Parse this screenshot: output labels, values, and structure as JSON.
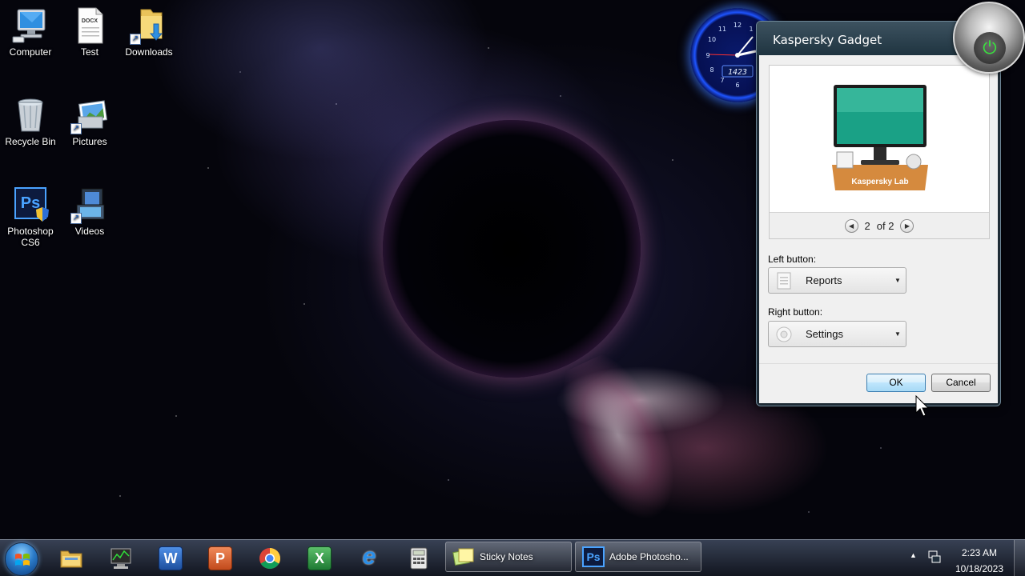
{
  "desktop": {
    "icons": [
      {
        "id": "computer",
        "label": "Computer",
        "icon": "computer-icon"
      },
      {
        "id": "test",
        "label": "Test",
        "icon": "docx-file-icon",
        "badge": "DOCX"
      },
      {
        "id": "downloads",
        "label": "Downloads",
        "icon": "downloads-folder-icon"
      },
      {
        "id": "recycle",
        "label": "Recycle Bin",
        "icon": "recycle-bin-icon"
      },
      {
        "id": "pictures",
        "label": "Pictures",
        "icon": "pictures-icon"
      },
      {
        "id": "photoshop",
        "label": "Photoshop CS6",
        "icon": "photoshop-icon",
        "glyph": "Ps"
      },
      {
        "id": "videos",
        "label": "Videos",
        "icon": "videos-icon"
      }
    ]
  },
  "clock_gadget": {
    "numbers": [
      "12",
      "1",
      "2",
      "10",
      "11",
      "9",
      "8",
      "7",
      "6"
    ],
    "digital": "1423"
  },
  "kaspersky": {
    "title": "Kaspersky Gadget",
    "preview_label": "Kaspersky Lab",
    "page_current": "2",
    "page_of": "of 2",
    "left_button_label": "Left button:",
    "left_button_value": "Reports",
    "right_button_label": "Right button:",
    "right_button_value": "Settings",
    "ok_label": "OK",
    "cancel_label": "Cancel"
  },
  "taskbar": {
    "pinned": [
      {
        "id": "explorer",
        "icon": "folder-icon"
      },
      {
        "id": "task-manager",
        "icon": "task-manager-icon"
      },
      {
        "id": "word",
        "icon": "word-icon",
        "glyph": "W"
      },
      {
        "id": "powerpoint",
        "icon": "powerpoint-icon",
        "glyph": "P"
      },
      {
        "id": "chrome",
        "icon": "chrome-icon"
      },
      {
        "id": "excel",
        "icon": "excel-icon",
        "glyph": "X"
      },
      {
        "id": "ie",
        "icon": "internet-explorer-icon",
        "glyph": "e"
      },
      {
        "id": "calculator",
        "icon": "calculator-icon"
      }
    ],
    "tasks": [
      {
        "id": "sticky",
        "label": "Sticky Notes",
        "icon": "sticky-notes-icon"
      },
      {
        "id": "photoshop",
        "label": "Adobe Photosho...",
        "icon": "photoshop-icon",
        "glyph": "Ps"
      }
    ],
    "time": "2:23 AM",
    "date": "10/18/2023"
  },
  "colors": {
    "accent_blue": "#3c7fb1",
    "power_green": "#39e23e",
    "window_frame": "#1f2c36"
  }
}
